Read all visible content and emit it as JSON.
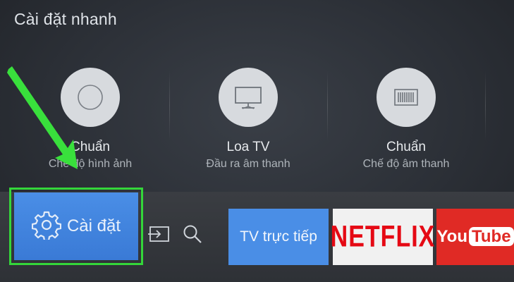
{
  "panel": {
    "title": "Cài đặt nhanh"
  },
  "quick_settings": [
    {
      "label": "Chuẩn",
      "sub": "Chế độ hình ảnh",
      "icon": "picture-mode-icon"
    },
    {
      "label": "Loa TV",
      "sub": "Đầu ra âm thanh",
      "icon": "tv-speaker-icon"
    },
    {
      "label": "Chuẩn",
      "sub": "Chế độ âm thanh",
      "icon": "sound-mode-icon"
    }
  ],
  "bottom_bar": {
    "settings_label": "Cài đặt",
    "source_icon": "input-source-icon",
    "search_icon": "search-icon",
    "apps": [
      {
        "label": "TV trực tiếp"
      },
      {
        "label": "NETFLIX"
      },
      {
        "label": "YouTube"
      }
    ]
  },
  "colors": {
    "highlight_frame": "#34d63a",
    "settings_tile": "#4a8ee6",
    "netflix_red": "#e50914",
    "youtube_red": "#e02a25",
    "arrow": "#39e03c"
  }
}
